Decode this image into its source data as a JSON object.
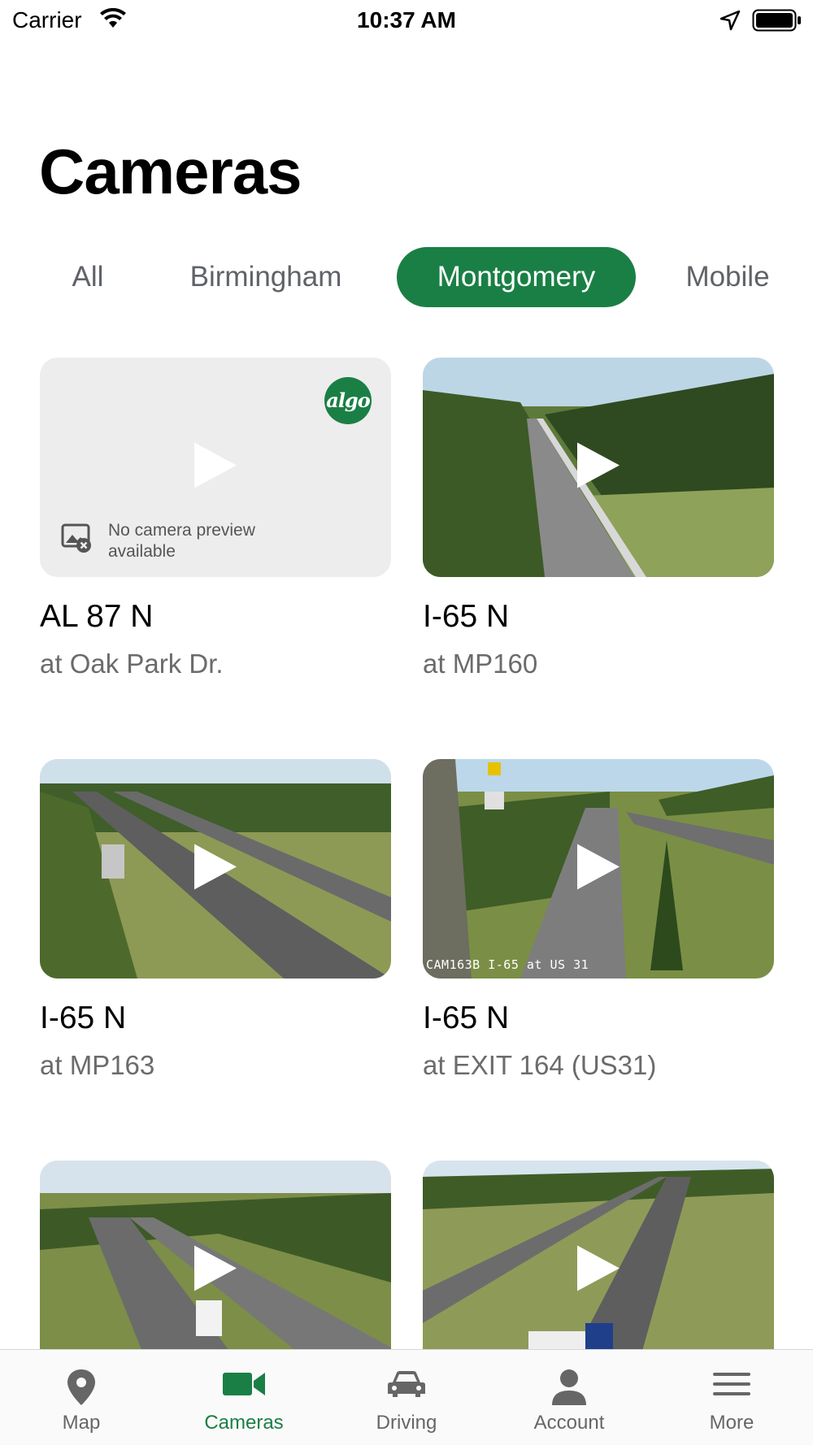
{
  "status_bar": {
    "carrier": "Carrier",
    "time": "10:37 AM"
  },
  "header": {
    "title": "Cameras"
  },
  "tabs": [
    {
      "label": "All",
      "active": false
    },
    {
      "label": "Birmingham",
      "active": false
    },
    {
      "label": "Montgomery",
      "active": true
    },
    {
      "label": "Mobile",
      "active": false
    }
  ],
  "cameras": [
    {
      "title": "AL 87 N",
      "subtitle": "at Oak Park Dr.",
      "preview_available": false,
      "badge": "algo",
      "no_preview_text": "No camera preview available"
    },
    {
      "title": "I-65 N",
      "subtitle": "at MP160",
      "preview_available": true
    },
    {
      "title": "I-65 N",
      "subtitle": "at MP163",
      "preview_available": true
    },
    {
      "title": "I-65 N",
      "subtitle": "at EXIT 164 (US31)",
      "preview_available": true,
      "overlay_text": "CAM163B I-65 at US 31"
    },
    {
      "title": "",
      "subtitle": "",
      "preview_available": true
    },
    {
      "title": "",
      "subtitle": "",
      "preview_available": true
    }
  ],
  "bottom_nav": [
    {
      "label": "Map",
      "icon": "map-pin-icon",
      "active": false
    },
    {
      "label": "Cameras",
      "icon": "video-camera-icon",
      "active": true
    },
    {
      "label": "Driving",
      "icon": "car-icon",
      "active": false
    },
    {
      "label": "Account",
      "icon": "person-icon",
      "active": false
    },
    {
      "label": "More",
      "icon": "hamburger-menu-icon",
      "active": false
    }
  ],
  "colors": {
    "accent": "#1a7f45",
    "tab_inactive": "#5f6368",
    "subtitle": "#6b6b6b"
  }
}
